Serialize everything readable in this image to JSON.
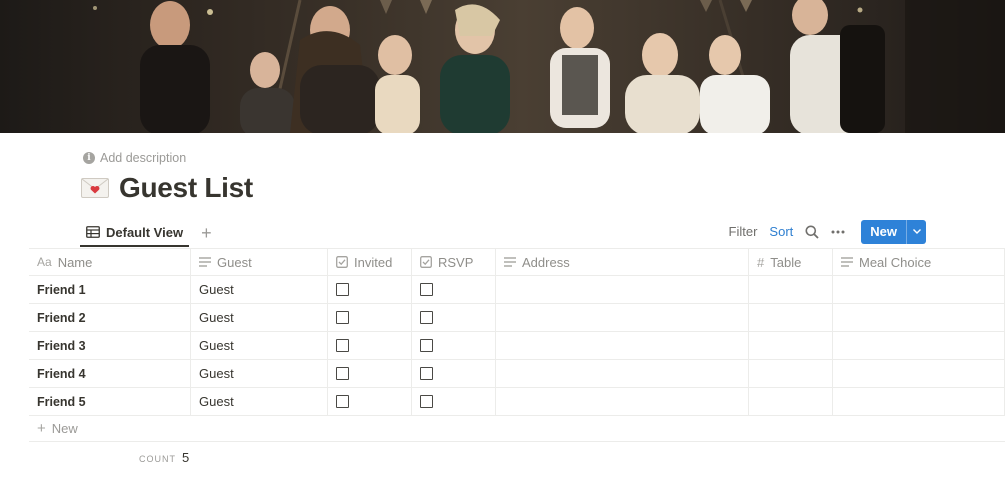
{
  "header": {
    "add_description": "Add description",
    "title": "Guest List",
    "icon": "love-letter-envelope-icon"
  },
  "views": {
    "active_tab": "Default View"
  },
  "toolbar": {
    "filter_label": "Filter",
    "sort_label": "Sort",
    "new_label": "New"
  },
  "colors": {
    "accent": "#2e82d8",
    "sort": "#2e7fd0",
    "text": "#37352f",
    "muted": "#9b9a97"
  },
  "table": {
    "columns": [
      "Name",
      "Guest",
      "Invited",
      "RSVP",
      "Address",
      "Table",
      "Meal Choice"
    ],
    "name_prefix": "Aa",
    "rows": [
      {
        "name": "Friend 1",
        "guest": "Guest"
      },
      {
        "name": "Friend 2",
        "guest": "Guest"
      },
      {
        "name": "Friend 3",
        "guest": "Guest"
      },
      {
        "name": "Friend 4",
        "guest": "Guest"
      },
      {
        "name": "Friend 5",
        "guest": "Guest"
      }
    ],
    "add_row_label": "New",
    "count_label": "COUNT",
    "count_value": "5"
  }
}
